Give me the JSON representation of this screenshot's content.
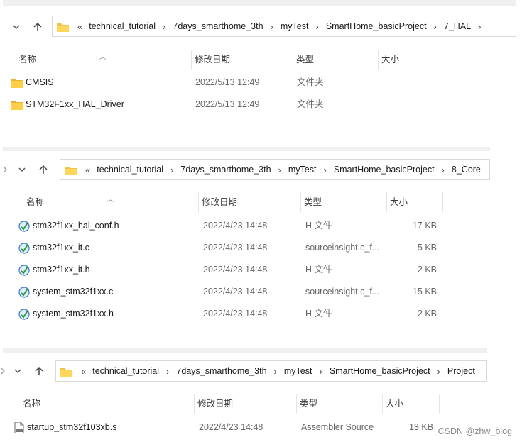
{
  "panels": [
    {
      "breadcrumb": [
        "technical_tutorial",
        "7days_smarthome_3th",
        "myTest",
        "SmartHome_basicProject",
        "7_HAL"
      ],
      "columns": {
        "name": "名称",
        "date": "修改日期",
        "type": "类型",
        "size": "大小"
      },
      "rows": [
        {
          "name": "CMSIS",
          "date": "2022/5/13 12:49",
          "type": "文件夹",
          "size": "",
          "icon": "folder-icon"
        },
        {
          "name": "STM32F1xx_HAL_Driver",
          "date": "2022/5/13 12:49",
          "type": "文件夹",
          "size": "",
          "icon": "folder-icon"
        }
      ]
    },
    {
      "breadcrumb": [
        "technical_tutorial",
        "7days_smarthome_3th",
        "myTest",
        "SmartHome_basicProject",
        "8_Core"
      ],
      "columns": {
        "name": "名称",
        "date": "修改日期",
        "type": "类型",
        "size": "大小"
      },
      "rows": [
        {
          "name": "stm32f1xx_hal_conf.h",
          "date": "2022/4/23 14:48",
          "type": "H 文件",
          "size": "17 KB",
          "icon": "sourceinsight-file-icon"
        },
        {
          "name": "stm32f1xx_it.c",
          "date": "2022/4/23 14:48",
          "type": "sourceinsight.c_f...",
          "size": "5 KB",
          "icon": "sourceinsight-file-icon"
        },
        {
          "name": "stm32f1xx_it.h",
          "date": "2022/4/23 14:48",
          "type": "H 文件",
          "size": "2 KB",
          "icon": "sourceinsight-file-icon"
        },
        {
          "name": "system_stm32f1xx.c",
          "date": "2022/4/23 14:48",
          "type": "sourceinsight.c_f...",
          "size": "15 KB",
          "icon": "sourceinsight-file-icon"
        },
        {
          "name": "system_stm32f1xx.h",
          "date": "2022/4/23 14:48",
          "type": "H 文件",
          "size": "2 KB",
          "icon": "sourceinsight-file-icon"
        }
      ]
    },
    {
      "breadcrumb": [
        "technical_tutorial",
        "7days_smarthome_3th",
        "myTest",
        "SmartHome_basicProject",
        "Project"
      ],
      "columns": {
        "name": "名称",
        "date": "修改日期",
        "type": "类型",
        "size": "大小"
      },
      "rows": [
        {
          "name": "startup_stm32f103xb.s",
          "date": "2022/4/23 14:48",
          "type": "Assembler Source",
          "size": "13 KB",
          "icon": "asm-file-icon"
        }
      ]
    }
  ],
  "watermark": "CSDN @zhw_blog"
}
